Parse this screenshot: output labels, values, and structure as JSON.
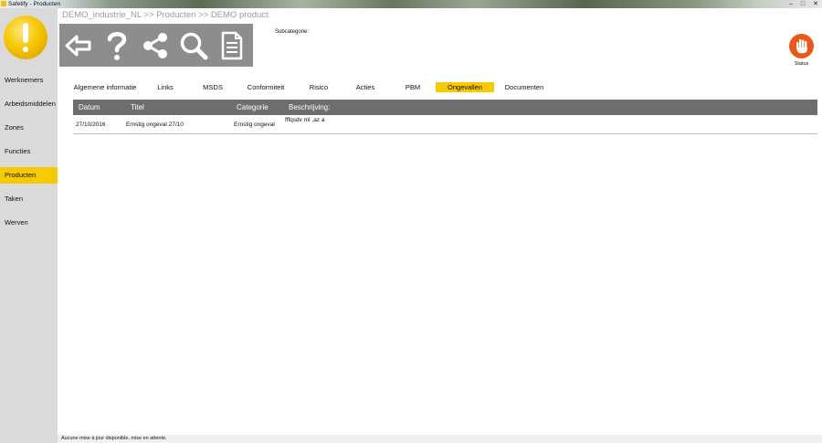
{
  "window": {
    "title": "Safetify - Producten",
    "controls": [
      "–",
      "□",
      "✕"
    ]
  },
  "sidebar": {
    "items": [
      {
        "label": "Werknemers",
        "active": false
      },
      {
        "label": "Arbeidsmiddelen",
        "active": false
      },
      {
        "label": "Zones",
        "active": false
      },
      {
        "label": "Functies",
        "active": false
      },
      {
        "label": "Producten",
        "active": true
      },
      {
        "label": "Taken",
        "active": false
      },
      {
        "label": "Werven",
        "active": false
      }
    ]
  },
  "breadcrumb": "DEMO_industrie_NL >> Producten >> DEMO product",
  "toolbar": {
    "icons": [
      "back-arrow-icon",
      "help-icon",
      "share-icon",
      "search-icon",
      "document-icon"
    ]
  },
  "subcategory_label": "Subcategorie:",
  "status": {
    "label": "Status",
    "icon": "stop-hand-icon",
    "color": "#e8581b"
  },
  "tabs": [
    {
      "label": "Algemene informatie",
      "active": false
    },
    {
      "label": "Links",
      "active": false
    },
    {
      "label": "MSDS",
      "active": false
    },
    {
      "label": "Conformiteit",
      "active": false
    },
    {
      "label": "Risico",
      "active": false
    },
    {
      "label": "Acties",
      "active": false
    },
    {
      "label": "PBM",
      "active": false
    },
    {
      "label": "Ongevallen",
      "active": true
    },
    {
      "label": "Documenten",
      "active": false
    }
  ],
  "table": {
    "columns": [
      "Datum",
      "Titel",
      "Categorie",
      "Beschrijving:"
    ],
    "rows": [
      [
        "27/10/2016",
        "Ernstig ongeval 27/10",
        "Ernstig ongeval",
        "fffqsdv ml ,az a"
      ]
    ]
  },
  "status_bar": "Aucune mise à jour disponible, mise en attente.",
  "colors": {
    "accent": "#f7c900",
    "toolbar": "#8d8d8d",
    "table_header": "#6e6e6e",
    "sidebar": "#dadada"
  }
}
